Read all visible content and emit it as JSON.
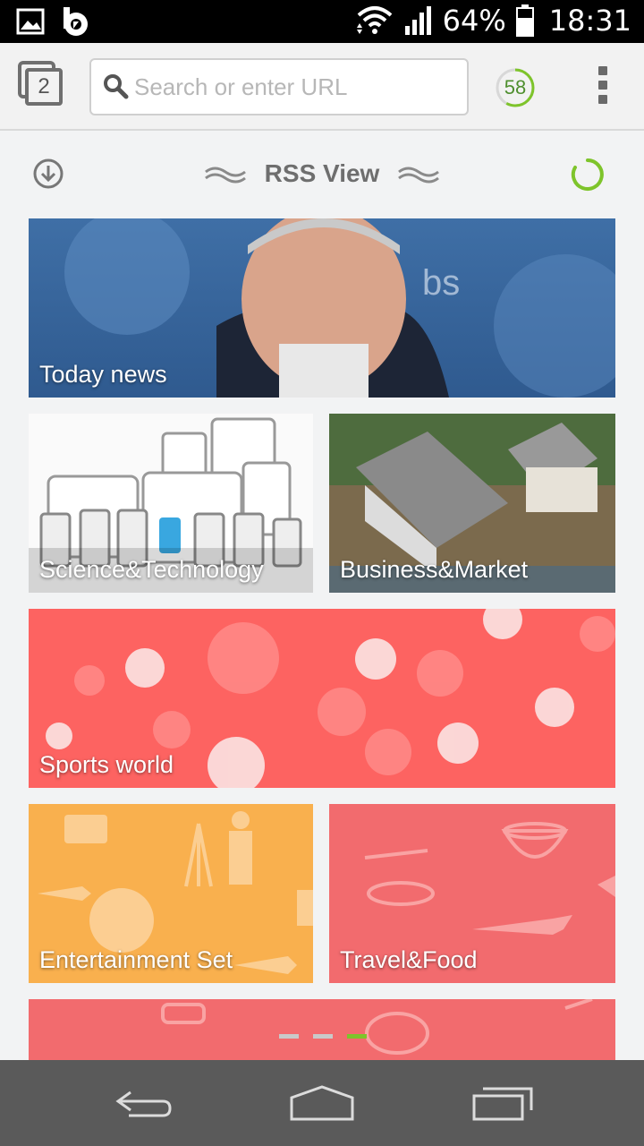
{
  "status_bar": {
    "battery_percent": "64%",
    "time": "18:31",
    "icons": [
      "gallery-icon",
      "b-app-icon",
      "wifi-icon",
      "signal-icon",
      "battery-icon"
    ]
  },
  "toolbar": {
    "tab_count": "2",
    "search_placeholder": "Search or enter URL",
    "score_value": "58",
    "score_fraction": 0.58,
    "icons": [
      "tabs-icon",
      "search-icon",
      "menu-icon"
    ]
  },
  "rss": {
    "title": "RSS View",
    "icons": [
      "download-icon",
      "wave-left-icon",
      "wave-right-icon",
      "loading-spinner-icon"
    ]
  },
  "tiles": [
    {
      "label": "Today news"
    },
    {
      "label": "Science&Technology"
    },
    {
      "label": "Business&Market"
    },
    {
      "label": "Sports world"
    },
    {
      "label": "Entertainment Set"
    },
    {
      "label": "Travel&Food"
    }
  ],
  "pager": {
    "count": 3,
    "active_index": 2
  },
  "colors": {
    "accent_green": "#7ec42b",
    "sports": "#fd6361",
    "entertainment": "#f9b04e",
    "travel": "#f26b6e"
  },
  "nav_bar": {
    "icons": [
      "back-icon",
      "home-icon",
      "recent-apps-icon"
    ]
  }
}
